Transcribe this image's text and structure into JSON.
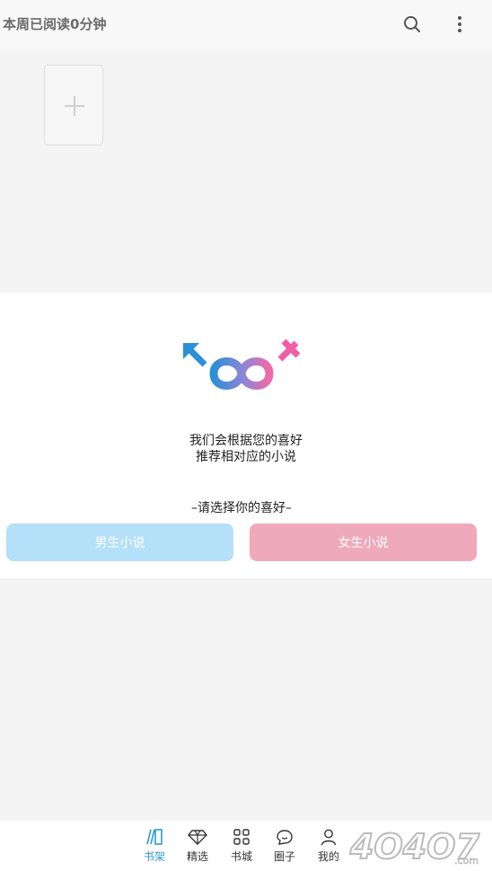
{
  "header": {
    "title": "本周已阅读0分钟",
    "search_icon": "search-icon",
    "more_icon": "more-vertical-icon"
  },
  "shelf": {
    "add_icon": "plus-icon"
  },
  "preference": {
    "logo": "gender-infinity-logo",
    "message_line1": "我们会根据您的喜好",
    "message_line2": "推荐相对应的小说",
    "choose_label": "–请选择你的喜好–",
    "male_button": "男生小说",
    "female_button": "女生小说",
    "colors": {
      "male": "#b4e0f9",
      "female": "#eeaabb"
    }
  },
  "nav": {
    "items": [
      {
        "label": "书架",
        "icon": "bookshelf-icon",
        "active": true
      },
      {
        "label": "精选",
        "icon": "diamond-icon",
        "active": false
      },
      {
        "label": "书城",
        "icon": "grid-icon",
        "active": false
      },
      {
        "label": "圈子",
        "icon": "chat-bubble-icon",
        "active": false
      },
      {
        "label": "我的",
        "icon": "person-icon",
        "active": false
      }
    ],
    "active_color": "#2e9ad6"
  },
  "watermark": {
    "text": "4O4O7.com"
  }
}
